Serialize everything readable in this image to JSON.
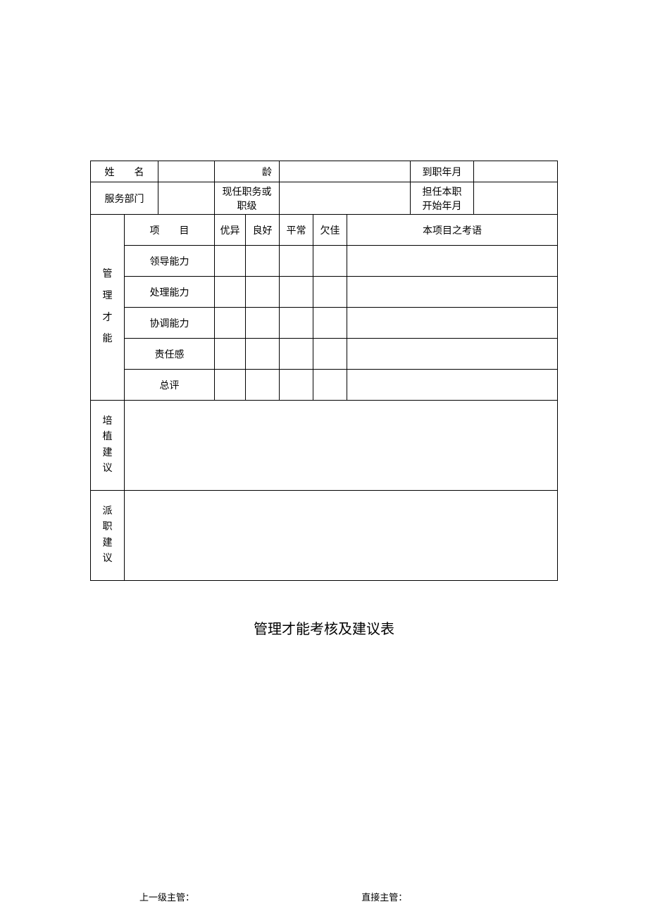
{
  "header": {
    "name_label": "姓　　名",
    "age_label": "龄",
    "start_label": "到职年月",
    "dept_label": "服务部门",
    "position_label_l1": "现任职务或",
    "position_label_l2": "职级",
    "current_start_l1": "担任本职",
    "current_start_l2": "开始年月"
  },
  "eval": {
    "side_label_1": "管",
    "side_label_2": "理",
    "side_label_3": "才",
    "side_label_4": "能",
    "col_item": "项　　目",
    "col_excellent": "优异",
    "col_good": "良好",
    "col_average": "平常",
    "col_poor": "欠佳",
    "col_comment": "本项目之考语",
    "rows": [
      {
        "label": "领导能力"
      },
      {
        "label": "处理能力"
      },
      {
        "label": "协调能力"
      },
      {
        "label": "责任感"
      },
      {
        "label": "总评"
      }
    ]
  },
  "sections": {
    "cultivate": "培\n植\n建\n议",
    "assign": "派\n职\n建\n议"
  },
  "title": "管理才能考核及建议表",
  "footer": {
    "left": "上一级主管：",
    "right": "直接主管："
  }
}
